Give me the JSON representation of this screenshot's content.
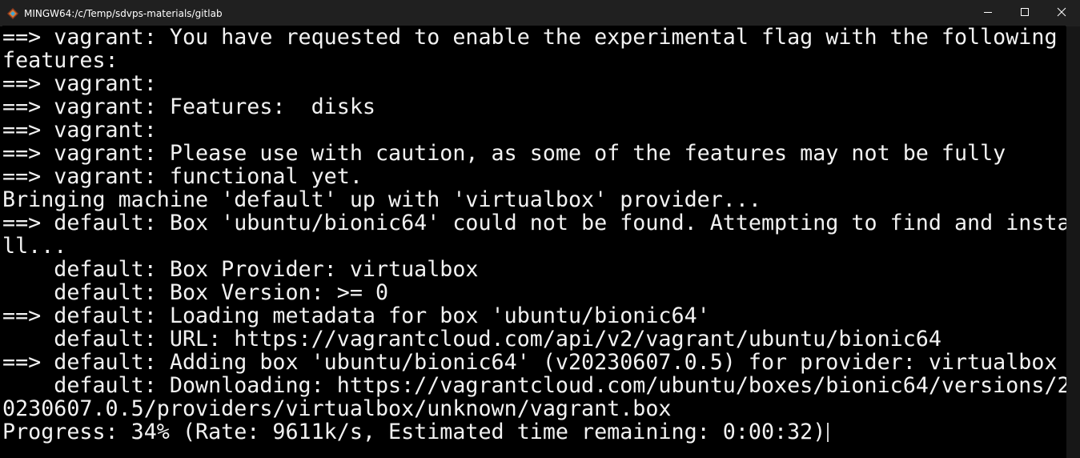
{
  "window": {
    "title": "MINGW64:/c/Temp/sdvps-materials/gitlab",
    "icon": "mingw-diamond-icon",
    "controls": {
      "minimize_icon": "minimize-icon",
      "maximize_icon": "maximize-icon",
      "close_icon": "close-icon"
    }
  },
  "terminal": {
    "lines": [
      "==> vagrant: You have requested to enable the experimental flag with the following",
      "features:",
      "==> vagrant:",
      "==> vagrant: Features:  disks",
      "==> vagrant:",
      "==> vagrant: Please use with caution, as some of the features may not be fully",
      "==> vagrant: functional yet.",
      "Bringing machine 'default' up with 'virtualbox' provider...",
      "==> default: Box 'ubuntu/bionic64' could not be found. Attempting to find and insta",
      "ll...",
      "    default: Box Provider: virtualbox",
      "    default: Box Version: >= 0",
      "==> default: Loading metadata for box 'ubuntu/bionic64'",
      "    default: URL: https://vagrantcloud.com/api/v2/vagrant/ubuntu/bionic64",
      "==> default: Adding box 'ubuntu/bionic64' (v20230607.0.5) for provider: virtualbox",
      "    default: Downloading: https://vagrantcloud.com/ubuntu/boxes/bionic64/versions/2",
      "0230607.0.5/providers/virtualbox/unknown/vagrant.box",
      "Progress: 34% (Rate: 9611k/s, Estimated time remaining: 0:00:32)"
    ]
  },
  "colors": {
    "background": "#000000",
    "foreground": "#f2f2f2",
    "titlebar": "#202020"
  }
}
